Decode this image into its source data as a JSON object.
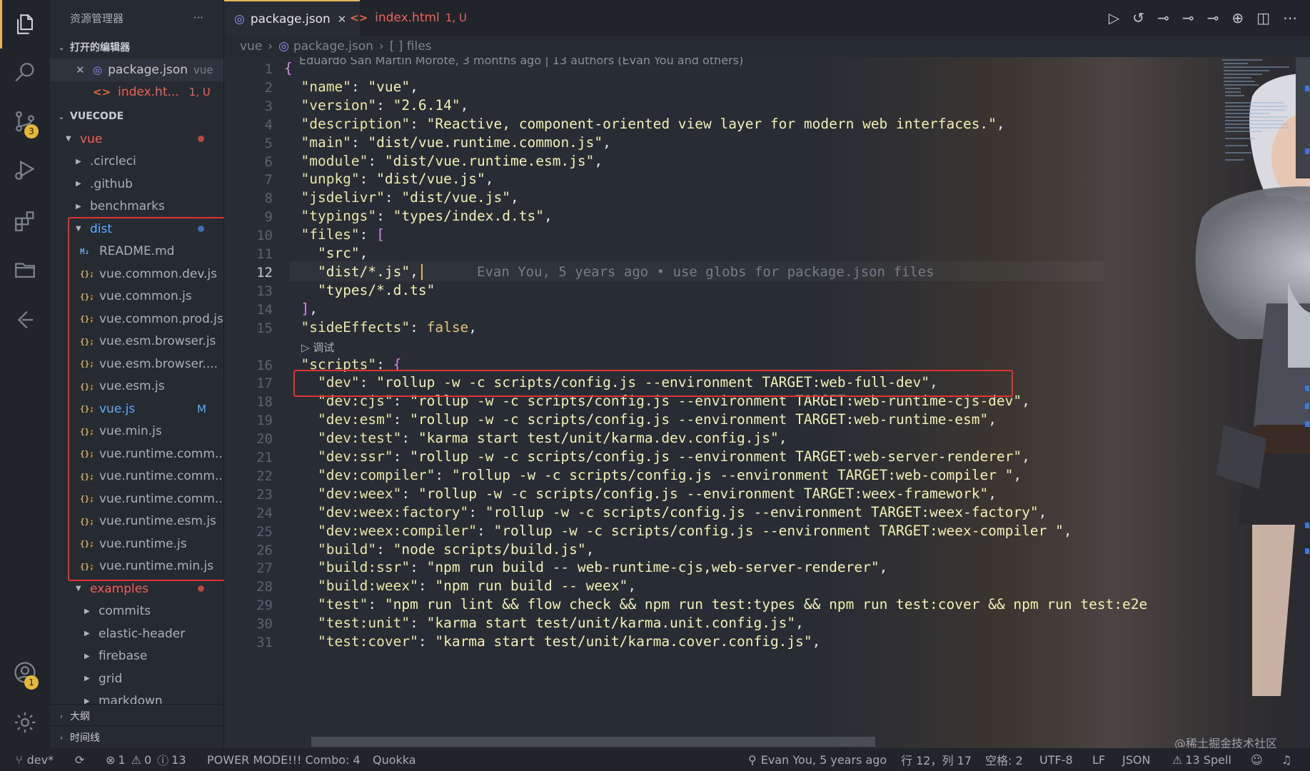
{
  "activity_bar": {
    "scm_badge": "3",
    "account_badge": "1"
  },
  "sidebar": {
    "title": "资源管理器",
    "more": "···",
    "open_editors_header": "打开的编辑器",
    "open_editors": [
      {
        "close": "✕",
        "name": "package.json",
        "hint": "vue"
      },
      {
        "name": "index.ht...",
        "hint": "1, U"
      }
    ],
    "workspace_header": "VUECODE",
    "root_folder": "vue",
    "folders_top": [
      ".circleci",
      ".github",
      "benchmarks"
    ],
    "dist_folder": "dist",
    "dist_files": [
      {
        "icon": "M↓",
        "name": "README.md"
      },
      {
        "icon": "{};",
        "name": "vue.common.dev.js"
      },
      {
        "icon": "{};",
        "name": "vue.common.js"
      },
      {
        "icon": "{};",
        "name": "vue.common.prod.js"
      },
      {
        "icon": "{};",
        "name": "vue.esm.browser.js"
      },
      {
        "icon": "{};",
        "name": "vue.esm.browser...."
      },
      {
        "icon": "{};",
        "name": "vue.esm.js"
      },
      {
        "icon": "{};",
        "name": "vue.js",
        "status": "M"
      },
      {
        "icon": "{};",
        "name": "vue.min.js"
      },
      {
        "icon": "{};",
        "name": "vue.runtime.comm..."
      },
      {
        "icon": "{};",
        "name": "vue.runtime.comm..."
      },
      {
        "icon": "{};",
        "name": "vue.runtime.comm..."
      },
      {
        "icon": "{};",
        "name": "vue.runtime.esm.js"
      },
      {
        "icon": "{};",
        "name": "vue.runtime.js"
      },
      {
        "icon": "{};",
        "name": "vue.runtime.min.js"
      }
    ],
    "examples_folder": "examples",
    "example_items": [
      "commits",
      "elastic-header",
      "firebase",
      "grid",
      "markdown"
    ],
    "outline_header": "大纲",
    "timeline_header": "时间线"
  },
  "tabs": [
    {
      "label": "package.json",
      "status": ""
    },
    {
      "label": "index.html",
      "status": "1, U"
    }
  ],
  "breadcrumb": {
    "root": "vue",
    "file": "package.json",
    "node": "[ ] files"
  },
  "blame_header": "Eduardo San Martin Morote, 3 months ago | 13 authors (Evan You and others)",
  "inline_blame": "Evan You, 5 years ago • use globs for package.json files",
  "codelens": "▷ 调试",
  "code_lines": [
    {
      "n": "1",
      "html": "<span class='b'>{</span>"
    },
    {
      "n": "2",
      "html": "  <span class='k'>\"name\"</span>: <span class='s'>\"vue\"</span>,"
    },
    {
      "n": "3",
      "html": "  <span class='k'>\"version\"</span>: <span class='s'>\"2.6.14\"</span>,"
    },
    {
      "n": "4",
      "html": "  <span class='k'>\"description\"</span>: <span class='s'>\"Reactive, component-oriented view layer for modern web interfaces.\"</span>,"
    },
    {
      "n": "5",
      "html": "  <span class='k'>\"main\"</span>: <span class='s'>\"dist/vue.runtime.common.js\"</span>,"
    },
    {
      "n": "6",
      "html": "  <span class='k'>\"module\"</span>: <span class='s'>\"dist/vue.runtime.esm.js\"</span>,"
    },
    {
      "n": "7",
      "html": "  <span class='k'>\"unpkg\"</span>: <span class='s'>\"dist/vue.js\"</span>,"
    },
    {
      "n": "8",
      "html": "  <span class='k'>\"jsdelivr\"</span>: <span class='s'>\"dist/vue.js\"</span>,"
    },
    {
      "n": "9",
      "html": "  <span class='k'>\"typings\"</span>: <span class='s'>\"types/index.d.ts\"</span>,"
    },
    {
      "n": "10",
      "html": "  <span class='k'>\"files\"</span>: <span class='b'>[</span>"
    },
    {
      "n": "11",
      "html": "    <span class='s'>\"src\"</span>,"
    },
    {
      "n": "12",
      "html": "    <span class='s'>\"dist/*.js\"</span>,"
    },
    {
      "n": "13",
      "html": "    <span class='s'>\"types/*.d.ts\"</span>"
    },
    {
      "n": "14",
      "html": "  <span class='b'>]</span>,"
    },
    {
      "n": "15",
      "html": "  <span class='k'>\"sideEffects\"</span>: <span class='kw'>false</span>,"
    },
    {
      "n": "16",
      "html": "  <span class='k'>\"scripts\"</span>: <span class='b'>{</span>"
    },
    {
      "n": "17",
      "html": "    <span class='k'>\"dev\"</span>: <span class='s'>\"rollup -w -c scripts/config.js --environment TARGET:web-full-dev\"</span>,"
    },
    {
      "n": "18",
      "html": "    <span class='k'>\"dev:cjs\"</span>: <span class='s'>\"rollup -w -c scripts/config.js --environment TARGET:web-runtime-cjs-dev\"</span>,"
    },
    {
      "n": "19",
      "html": "    <span class='k'>\"dev:esm\"</span>: <span class='s'>\"rollup -w -c scripts/config.js --environment TARGET:web-runtime-esm\"</span>,"
    },
    {
      "n": "20",
      "html": "    <span class='k'>\"dev:test\"</span>: <span class='s'>\"karma start test/unit/karma.dev.config.js\"</span>,"
    },
    {
      "n": "21",
      "html": "    <span class='k'>\"dev:ssr\"</span>: <span class='s'>\"rollup -w -c scripts/config.js --environment TARGET:web-server-renderer\"</span>,"
    },
    {
      "n": "22",
      "html": "    <span class='k'>\"dev:compiler\"</span>: <span class='s'>\"rollup -w -c scripts/config.js --environment TARGET:web-compiler \"</span>,"
    },
    {
      "n": "23",
      "html": "    <span class='k'>\"dev:weex\"</span>: <span class='s'>\"rollup -w -c scripts/config.js --environment TARGET:weex-framework\"</span>,"
    },
    {
      "n": "24",
      "html": "    <span class='k'>\"dev:weex:factory\"</span>: <span class='s'>\"rollup -w -c scripts/config.js --environment TARGET:weex-factory\"</span>,"
    },
    {
      "n": "25",
      "html": "    <span class='k'>\"dev:weex:compiler\"</span>: <span class='s'>\"rollup -w -c scripts/config.js --environment TARGET:weex-compiler \"</span>,"
    },
    {
      "n": "26",
      "html": "    <span class='k'>\"build\"</span>: <span class='s'>\"node scripts/build.js\"</span>,"
    },
    {
      "n": "27",
      "html": "    <span class='k'>\"build:ssr\"</span>: <span class='s'>\"npm run build -- web-runtime-cjs,web-server-renderer\"</span>,"
    },
    {
      "n": "28",
      "html": "    <span class='k'>\"build:weex\"</span>: <span class='s'>\"npm run build -- weex\"</span>,"
    },
    {
      "n": "29",
      "html": "    <span class='k'>\"test\"</span>: <span class='s'>\"npm run lint &amp;&amp; flow check &amp;&amp; npm run test:types &amp;&amp; npm run test:cover &amp;&amp; npm run test:e2e</span>"
    },
    {
      "n": "30",
      "html": "    <span class='k'>\"test:unit\"</span>: <span class='s'>\"karma start test/unit/karma.unit.config.js\"</span>,"
    },
    {
      "n": "31",
      "html": "    <span class='k'>\"test:cover\"</span>: <span class='s'>\"karma start test/unit/karma.cover.config.js\"</span>,"
    }
  ],
  "status_bar": {
    "branch": "dev*",
    "errors": "1",
    "warnings": "0",
    "infos": "13",
    "power_mode": "POWER MODE!!! Combo: 4",
    "quokka": "Quokka",
    "blame": "Evan You, 5 years ago",
    "position": "行 12，列 17",
    "spaces": "空格: 2",
    "encoding": "UTF-8",
    "eol": "LF",
    "language": "JSON",
    "spell": "13 Spell"
  },
  "watermark": "@稀土掘金技术社区",
  "colors": {
    "accent": "#e5b45b",
    "highlight_box": "#e0322e",
    "untracked": "#e06c75",
    "modified": "#5cabff"
  }
}
